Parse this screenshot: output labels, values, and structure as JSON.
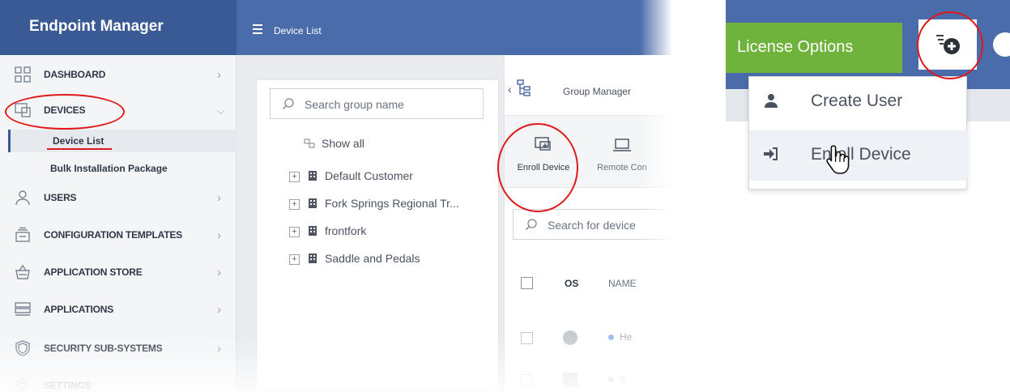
{
  "app": {
    "brand": "Endpoint Manager",
    "page_title": "Device List"
  },
  "sidebar": {
    "items": [
      {
        "label": "DASHBOARD",
        "icon": "dashboard-grid-icon"
      },
      {
        "label": "DEVICES",
        "icon": "devices-monitor-icon",
        "expanded": true
      },
      {
        "label": "USERS",
        "icon": "user-icon"
      },
      {
        "label": "CONFIGURATION TEMPLATES",
        "icon": "templates-icon"
      },
      {
        "label": "APPLICATION STORE",
        "icon": "store-basket-icon"
      },
      {
        "label": "APPLICATIONS",
        "icon": "applications-icon"
      },
      {
        "label": "SECURITY SUB-SYSTEMS",
        "icon": "shield-icon"
      },
      {
        "label": "SETTINGS",
        "icon": "gear-icon"
      }
    ],
    "sub_items": [
      {
        "label": "Device List",
        "active": true
      },
      {
        "label": "Bulk Installation Package"
      }
    ]
  },
  "groups": {
    "search_placeholder": "Search group name",
    "show_all": "Show all",
    "items": [
      "Default Customer",
      "Fork Springs Regional Tr...",
      "frontfork",
      "Saddle and Pedals"
    ]
  },
  "devices": {
    "group_management_label": "Group Manager",
    "toolbar": {
      "enroll_label": "Enroll Device",
      "remote_label": "Remote Con"
    },
    "search_placeholder": "Search for device",
    "columns": {
      "os": "OS",
      "name": "NAME"
    },
    "rows": [
      {
        "name_fragment": "He"
      },
      {
        "name_fragment": "S"
      }
    ]
  },
  "inset": {
    "license_button": "License Options",
    "add_icon": "add-user-plus-icon",
    "menu": [
      {
        "label": "Create User",
        "icon": "user-silhouette-icon"
      },
      {
        "label": "Enroll Device",
        "icon": "sign-in-arrow-icon",
        "hovered": true
      }
    ]
  },
  "colors": {
    "header": "#4a6cab",
    "brand_bar": "#3a5a95",
    "license_green": "#6fb23c",
    "annotation_red": "#e01818"
  }
}
